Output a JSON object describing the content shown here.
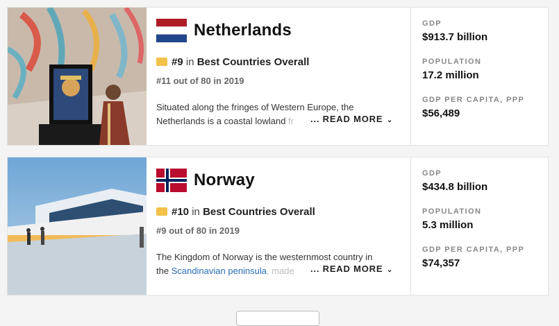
{
  "countries": [
    {
      "name": "Netherlands",
      "flag": "netherlands-flag",
      "rank": "#9",
      "rank_in": "in",
      "category": "Best Countries Overall",
      "previous": "#11 out of 80 in 2019",
      "description_main": "Situated along the fringes of Western Europe, the Netherlands is a coastal lowland",
      "description_fade": " fr",
      "read_more": "... READ MORE",
      "stats": [
        {
          "label": "GDP",
          "value": "$913.7 billion"
        },
        {
          "label": "POPULATION",
          "value": "17.2 million"
        },
        {
          "label": "GDP PER CAPITA, PPP",
          "value": "$56,489"
        }
      ]
    },
    {
      "name": "Norway",
      "flag": "norway-flag",
      "rank": "#10",
      "rank_in": "in",
      "category": "Best Countries Overall",
      "previous": "#9 out of 80 in 2019",
      "description_main": "The Kingdom of Norway is the westernmost country in the ",
      "description_link": "Scandinavian peninsula",
      "description_tail": ", made",
      "read_more": "... READ MORE",
      "stats": [
        {
          "label": "GDP",
          "value": "$434.8 billion"
        },
        {
          "label": "POPULATION",
          "value": "5.3 million"
        },
        {
          "label": "GDP PER CAPITA, PPP",
          "value": "$74,357"
        }
      ]
    }
  ],
  "colors": {
    "link": "#2a6db5",
    "medal": "#f2c14a",
    "stat_label": "#888888"
  }
}
